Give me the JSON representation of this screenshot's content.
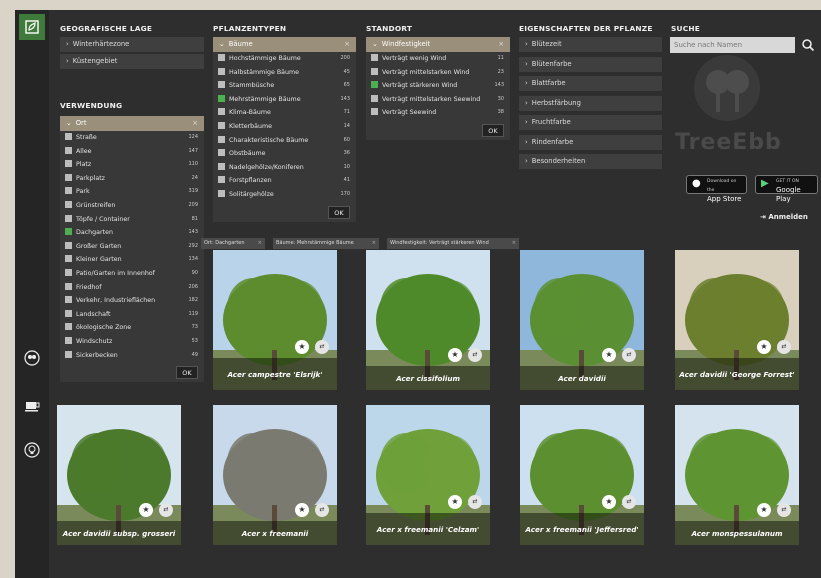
{
  "filters": {
    "geo": {
      "title": "GEOGRAFISCHE LAGE",
      "items": [
        "Winterhärtezone",
        "Küstengebiet"
      ]
    },
    "verwendung": {
      "title": "VERWENDUNG",
      "selected": "Ort",
      "options": [
        {
          "label": "Straße",
          "count": "124"
        },
        {
          "label": "Allee",
          "count": "147"
        },
        {
          "label": "Platz",
          "count": "110"
        },
        {
          "label": "Parkplatz",
          "count": "24"
        },
        {
          "label": "Park",
          "count": "319"
        },
        {
          "label": "Grünstreifen",
          "count": "209"
        },
        {
          "label": "Töpfe / Container",
          "count": "81"
        },
        {
          "label": "Dachgarten",
          "count": "143"
        },
        {
          "label": "Großer Garten",
          "count": "292"
        },
        {
          "label": "Kleiner Garten",
          "count": "134"
        },
        {
          "label": "Patio/Garten im Innenhof",
          "count": "90"
        },
        {
          "label": "Friedhof",
          "count": "206"
        },
        {
          "label": "Verkehr, Industrieflächen",
          "count": "182"
        },
        {
          "label": "Landschaft",
          "count": "119"
        },
        {
          "label": "ökologische Zone",
          "count": "73"
        },
        {
          "label": "Windschutz",
          "count": "53"
        },
        {
          "label": "Sickerbecken",
          "count": "49"
        }
      ],
      "checked": 7,
      "ok": "OK"
    },
    "pflanzentypen": {
      "title": "PFLANZENTYPEN",
      "selected": "Bäume",
      "options": [
        {
          "label": "Hochstämmige Bäume",
          "count": "200"
        },
        {
          "label": "Halbstämmige Bäume",
          "count": "45"
        },
        {
          "label": "Stammbüsche",
          "count": "65"
        },
        {
          "label": "Mehrstämmige Bäume",
          "count": "143"
        },
        {
          "label": "Klima-Bäume",
          "count": "71"
        },
        {
          "label": "Kletterbäume",
          "count": "14"
        },
        {
          "label": "Charakteristische Bäume",
          "count": "60"
        },
        {
          "label": "Obstbäume",
          "count": "36"
        },
        {
          "label": "Nadelgehölze/Koniferen",
          "count": "10"
        },
        {
          "label": "Forstpflanzen",
          "count": "41"
        },
        {
          "label": "Solitärgehölze",
          "count": "170"
        }
      ],
      "checked": 3,
      "ok": "OK"
    },
    "standort": {
      "title": "STANDORT",
      "selected": "Windfestigkeit",
      "options": [
        {
          "label": "Verträgt wenig Wind",
          "count": "11"
        },
        {
          "label": "Verträgt mittelstarken Wind",
          "count": "23"
        },
        {
          "label": "Verträgt stärkeren Wind",
          "count": "143"
        },
        {
          "label": "Verträgt mittelstarken Seewind",
          "count": "30"
        },
        {
          "label": "Verträgt Seewind",
          "count": "38"
        }
      ],
      "checked": 2,
      "ok": "OK"
    },
    "eigenschaften": {
      "title": "EIGENSCHAFTEN DER PFLANZE",
      "items": [
        "Blütezeit",
        "Blütenfarbe",
        "Blattfarbe",
        "Herbstfärbung",
        "Fruchtfarbe",
        "Rindenfarbe",
        "Besonderheiten"
      ]
    },
    "suche": {
      "title": "SUCHE",
      "placeholder": "Suche nach Namen"
    }
  },
  "brand": "TreeEbb",
  "stores": {
    "apple_small": "Download on the",
    "apple": "App Store",
    "google_small": "GET IT ON",
    "google": "Google Play"
  },
  "login": "Anmelden",
  "chips": [
    "Ort: Dachgarten",
    "Bäume: Mehrstämmige Bäume",
    "Windfestigkeit: Verträgt stärkeren Wind"
  ],
  "cards": [
    {
      "name": "Acer campestre 'Elsrijk'"
    },
    {
      "name": "Acer cissifolium"
    },
    {
      "name": "Acer davidii"
    },
    {
      "name": "Acer davidii 'George Forrest'"
    },
    {
      "name": "Acer davidii subsp. grosseri"
    },
    {
      "name": "Acer x freemanii"
    },
    {
      "name": "Acer x freemanii 'Celzam'"
    },
    {
      "name": "Acer x freemanii 'Jeffersred'"
    },
    {
      "name": "Acer monspessulanum"
    }
  ],
  "colors": {
    "accent_green": "#3e7a3a",
    "selected_tan": "#9a8f7a",
    "checked": "#4caf50"
  }
}
